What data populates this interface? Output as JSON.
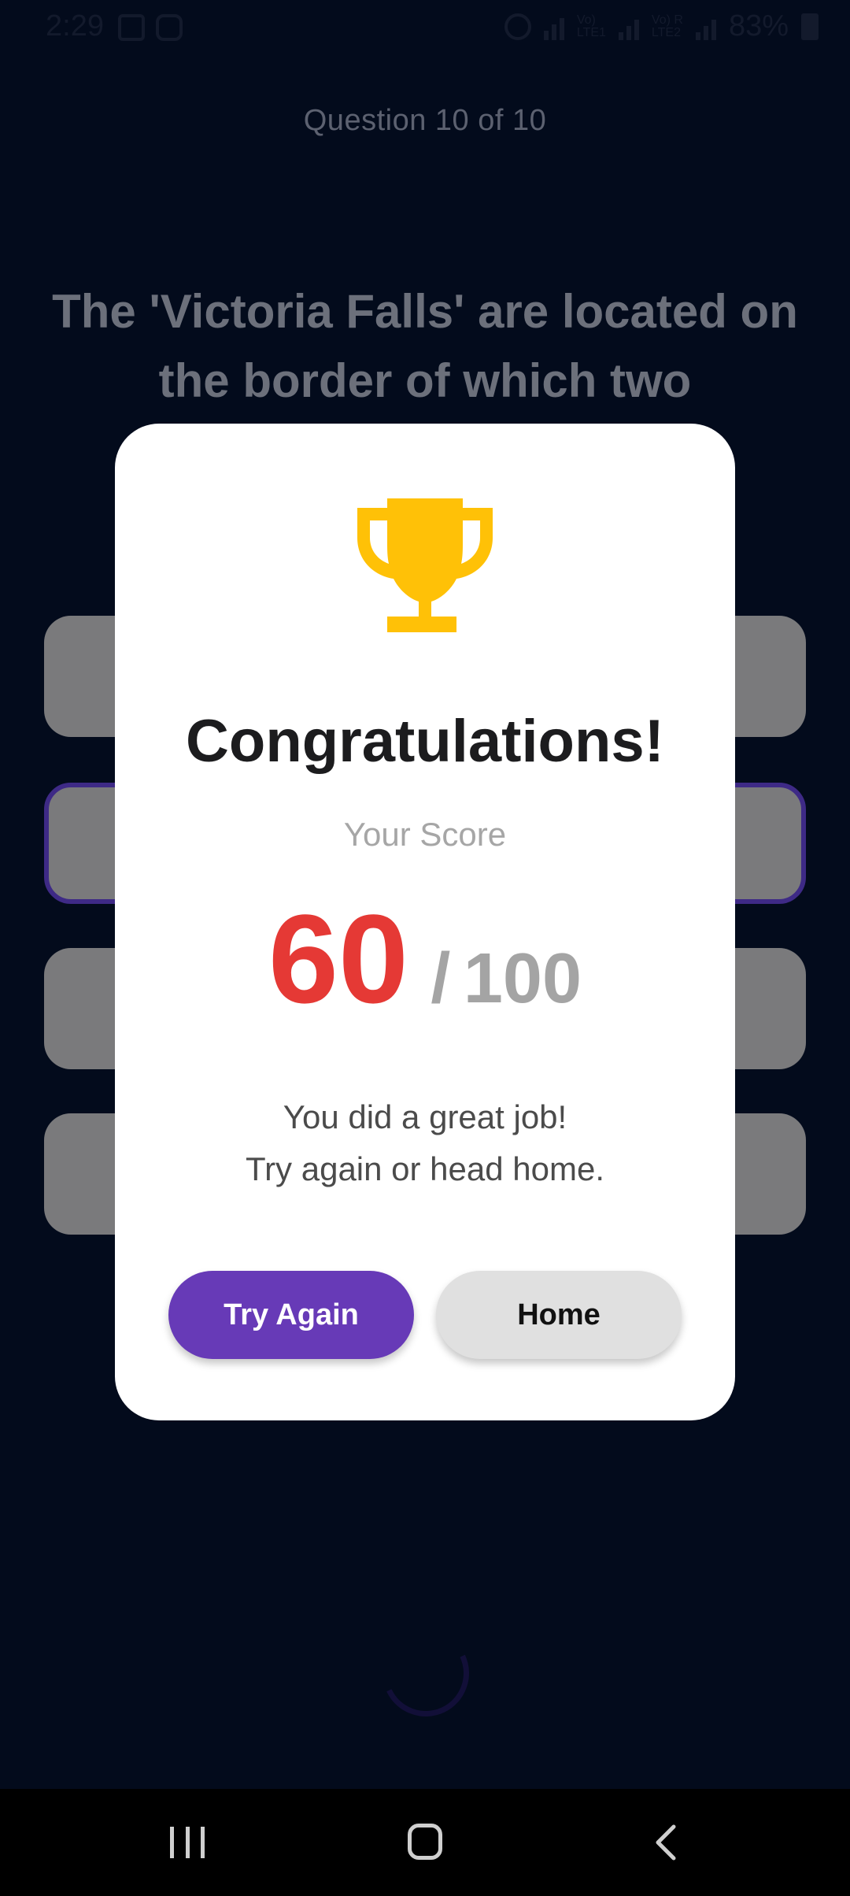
{
  "status_bar": {
    "time": "2:29",
    "network_1": "Vo)\nLTE1",
    "network_2": "Vo) R\nLTE2",
    "battery": "83%"
  },
  "quiz": {
    "counter": "Question 10 of 10",
    "question": "The 'Victoria Falls' are located on the border of which two"
  },
  "dialog": {
    "title": "Congratulations!",
    "score_label": "Your Score",
    "score": "60",
    "score_separator": "/",
    "score_total": "100",
    "message_line1": "You did a great job!",
    "message_line2": "Try again or head home.",
    "try_again_label": "Try Again",
    "home_label": "Home",
    "icon": "trophy-icon"
  },
  "colors": {
    "background": "#030b1c",
    "accent": "#673ab7",
    "score": "#e53935",
    "trophy": "#ffc107"
  },
  "navigation": {
    "recents_icon": "recents-icon",
    "home_icon": "home-icon",
    "back_icon": "back-icon"
  }
}
